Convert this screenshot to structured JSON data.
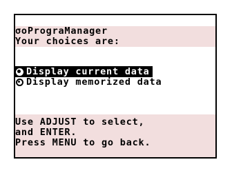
{
  "header": {
    "title": "σοPrograManager",
    "subtitle": "Your choices are:"
  },
  "options": [
    {
      "label": "Display current data",
      "selected": true
    },
    {
      "label": "Display memorized data",
      "selected": false
    }
  ],
  "instructions": {
    "line1": "Use ADJUST to select,",
    "line2": "and ENTER.",
    "line3": "Press MENU to go back."
  }
}
